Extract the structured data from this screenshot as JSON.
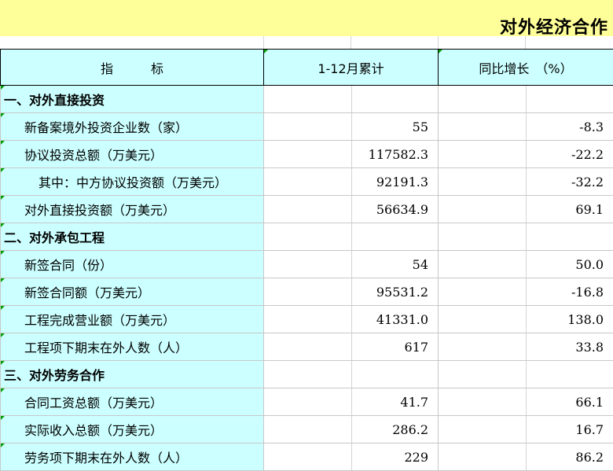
{
  "title": "对外经济合作",
  "header": {
    "indicator": "指　　　标",
    "cumulative": "1-12月累计",
    "growth": "同比增长　（%）"
  },
  "rows": [
    {
      "label": "一、对外直接投资",
      "value": "",
      "growth": "",
      "type": "section"
    },
    {
      "label": "新备案境外投资企业数（家）",
      "value": "55",
      "growth": "-8.3",
      "type": "item"
    },
    {
      "label": "协议投资总额（万美元）",
      "value": "117582.3",
      "growth": "-22.2",
      "type": "item"
    },
    {
      "label": "其中：中方协议投资额（万美元）",
      "value": "92191.3",
      "growth": "-32.2",
      "type": "sub"
    },
    {
      "label": "对外直接投资额（万美元）",
      "value": "56634.9",
      "growth": "69.1",
      "type": "item"
    },
    {
      "label": "二、对外承包工程",
      "value": "",
      "growth": "",
      "type": "section"
    },
    {
      "label": "新签合同（份）",
      "value": "54",
      "growth": "50.0",
      "type": "item"
    },
    {
      "label": "新签合同额（万美元）",
      "value": "95531.2",
      "growth": "-16.8",
      "type": "item"
    },
    {
      "label": "工程完成营业额（万美元）",
      "value": "41331.0",
      "growth": "138.0",
      "type": "item"
    },
    {
      "label": "工程项下期末在外人数（人）",
      "value": "617",
      "growth": "33.8",
      "type": "item"
    },
    {
      "label": "三、对外劳务合作",
      "value": "",
      "growth": "",
      "type": "section"
    },
    {
      "label": "合同工资总额（万美元）",
      "value": "41.7",
      "growth": "66.1",
      "type": "item"
    },
    {
      "label": "实际收入总额（万美元）",
      "value": "286.2",
      "growth": "16.7",
      "type": "item"
    },
    {
      "label": "劳务项下期末在外人数（人）",
      "value": "229",
      "growth": "86.2",
      "type": "item"
    }
  ]
}
